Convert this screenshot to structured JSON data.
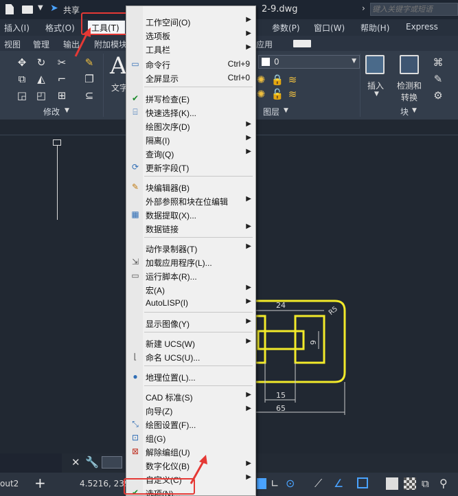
{
  "title_bar": {
    "share_label": "共享",
    "document_title": "2-9.dwg",
    "search_placeholder": "键入关键字或短语"
  },
  "menu_bar": [
    "插入(I)",
    "格式(O)",
    "工具(T)",
    "参数(P)",
    "窗口(W)",
    "帮助(H)",
    "Express"
  ],
  "ribbon_tabs": [
    "视图",
    "管理",
    "输出",
    "附加模块",
    "应用"
  ],
  "ribbon": {
    "modify_panel_label": "修改",
    "text_label": "文字",
    "layer_value": "0",
    "layers_panel_label": "图层",
    "insert_label": "插入",
    "detect_label": "检测和",
    "convert_label": "转换",
    "block_panel_label": "块"
  },
  "tools_menu": {
    "items": [
      {
        "label": "工作空间(O)",
        "submenu": true
      },
      {
        "label": "选项板",
        "submenu": true
      },
      {
        "label": "工具栏",
        "submenu": true
      },
      {
        "label": "命令行",
        "shortcut": "Ctrl+9",
        "icon": "command-line-icon"
      },
      {
        "label": "全屏显示",
        "shortcut": "Ctrl+0"
      },
      {
        "label": "拼写检查(E)",
        "icon": "spell-check-icon"
      },
      {
        "label": "快速选择(K)...",
        "icon": "quick-select-icon"
      },
      {
        "label": "绘图次序(D)",
        "submenu": true
      },
      {
        "label": "隔离(I)",
        "submenu": true
      },
      {
        "label": "查询(Q)",
        "submenu": true
      },
      {
        "label": "更新字段(T)",
        "icon": "update-fields-icon"
      },
      {
        "label": "块编辑器(B)",
        "icon": "block-editor-icon"
      },
      {
        "label": "外部参照和块在位编辑",
        "submenu": true
      },
      {
        "label": "数据提取(X)...",
        "icon": "data-extraction-icon"
      },
      {
        "label": "数据链接",
        "submenu": true
      },
      {
        "label": "动作录制器(T)",
        "submenu": true
      },
      {
        "label": "加载应用程序(L)...",
        "icon": "load-app-icon"
      },
      {
        "label": "运行脚本(R)...",
        "icon": "run-script-icon"
      },
      {
        "label": "宏(A)",
        "submenu": true
      },
      {
        "label": "AutoLISP(I)",
        "submenu": true
      },
      {
        "label": "显示图像(Y)",
        "submenu": true
      },
      {
        "label": "新建 UCS(W)",
        "submenu": true
      },
      {
        "label": "命名 UCS(U)...",
        "icon": "named-ucs-icon"
      },
      {
        "label": "地理位置(L)...",
        "icon": "globe-icon"
      },
      {
        "label": "CAD 标准(S)",
        "submenu": true
      },
      {
        "label": "向导(Z)",
        "submenu": true
      },
      {
        "label": "绘图设置(F)...",
        "icon": "drafting-settings-icon"
      },
      {
        "label": "组(G)",
        "icon": "group-icon"
      },
      {
        "label": "解除编组(U)",
        "icon": "ungroup-icon"
      },
      {
        "label": "数字化仪(B)",
        "submenu": true
      },
      {
        "label": "自定义(C)",
        "submenu": true
      },
      {
        "label": "选项(N)...",
        "icon": "options-check-icon"
      }
    ]
  },
  "drawing": {
    "dim_24": "24",
    "dim_9": "9",
    "dim_15": "15",
    "dim_65": "65",
    "radius_label": "R5"
  },
  "status_bar": {
    "layout_tab": "out2",
    "coordinates": "4.5216, 239."
  },
  "colors": {
    "highlight_red": "#e53935",
    "drawing_yellow": "#f2ea2a",
    "canvas_bg": "#212832",
    "menu_bg": "#f0f0f0"
  }
}
